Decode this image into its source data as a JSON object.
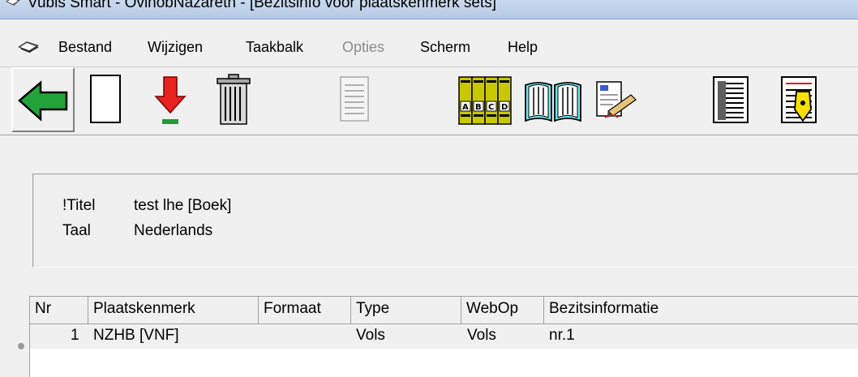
{
  "window": {
    "title": "Vubis Smart - OvinobNazareth - [Bezitsinfo voor plaatskenmerk sets]"
  },
  "menu": {
    "items": [
      {
        "label": "Bestand",
        "enabled": true
      },
      {
        "label": "Wijzigen",
        "enabled": true
      },
      {
        "label": "Taakbalk",
        "enabled": true
      },
      {
        "label": "Opties",
        "enabled": false
      },
      {
        "label": "Scherm",
        "enabled": true
      },
      {
        "label": "Help",
        "enabled": true
      }
    ]
  },
  "toolbar": {
    "buttons": [
      {
        "icon": "back-arrow-icon",
        "enabled": true
      },
      {
        "icon": "new-document-icon",
        "enabled": true
      },
      {
        "icon": "download-arrow-icon",
        "enabled": true
      },
      {
        "icon": "trash-icon",
        "enabled": true
      },
      {
        "icon": "page-icon",
        "enabled": false
      },
      {
        "icon": "abcd-books-icon",
        "enabled": true
      },
      {
        "icon": "open-book-icon",
        "enabled": true
      },
      {
        "icon": "edit-document-icon",
        "enabled": true
      },
      {
        "icon": "list-document-icon",
        "enabled": true
      },
      {
        "icon": "document-highlight-icon",
        "enabled": true
      }
    ]
  },
  "record": {
    "fields": [
      {
        "label": "!Titel",
        "value": "test lhe [Boek]"
      },
      {
        "label": "Taal",
        "value": "Nederlands"
      }
    ]
  },
  "grid": {
    "columns": [
      "Nr",
      "Plaatskenmerk",
      "Formaat",
      "Type",
      "WebOp",
      "Bezitsinformatie"
    ],
    "rows": [
      {
        "nr": "1",
        "plaatskenmerk": "NZHB [VNF]",
        "formaat": "",
        "type": "Vols",
        "webop": "Vols",
        "bezitsinformatie": "nr.1"
      }
    ]
  },
  "colors": {
    "background": "#f0f0f0",
    "back_arrow": "#22a43a",
    "download_arrow": "#e8231f",
    "books": "#c9c800"
  }
}
